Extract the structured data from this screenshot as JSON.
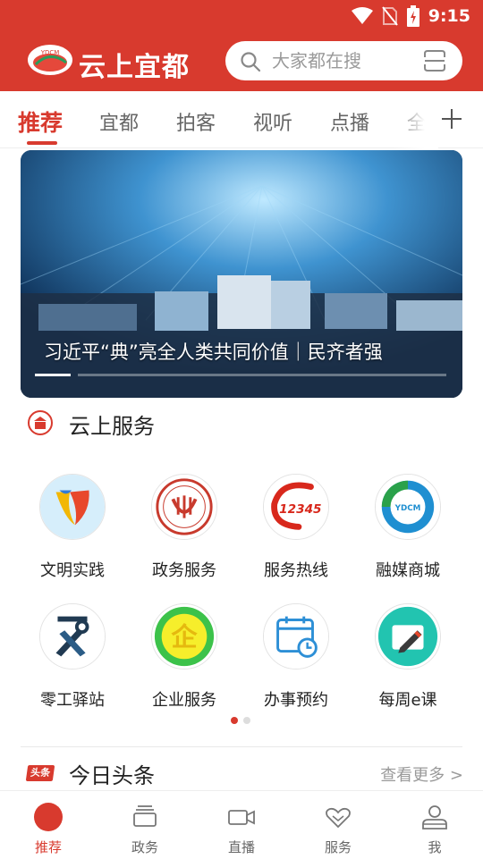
{
  "status_bar": {
    "time": "9:15"
  },
  "app": {
    "title": "云上宜都",
    "logo_text": "YDCM"
  },
  "search": {
    "placeholder": "大家都在搜"
  },
  "tabs": [
    {
      "label": "推荐",
      "active": true
    },
    {
      "label": "宜都"
    },
    {
      "label": "拍客"
    },
    {
      "label": "视听"
    },
    {
      "label": "点播"
    },
    {
      "label": "全"
    }
  ],
  "banner": {
    "caption": "习近平“典”亮全人类共同价值｜民齐者强"
  },
  "services_section": {
    "title": "云上服务",
    "items": [
      {
        "label": "文明实践",
        "icon": "civilization-icon"
      },
      {
        "label": "政务服务",
        "icon": "government-icon"
      },
      {
        "label": "服务热线",
        "icon": "hotline-12345-icon"
      },
      {
        "label": "融媒商城",
        "icon": "ydcm-mall-icon"
      },
      {
        "label": "零工驿站",
        "icon": "tools-icon"
      },
      {
        "label": "企业服务",
        "icon": "enterprise-icon",
        "glyph": "企"
      },
      {
        "label": "办事预约",
        "icon": "calendar-clock-icon"
      },
      {
        "label": "每周e课",
        "icon": "pencil-icon"
      }
    ],
    "hotline_number": "12345",
    "mall_logo_text": "YDCM"
  },
  "headlines": {
    "badge": "头条",
    "title": "今日头条",
    "more": "查看更多 >"
  },
  "bottom_nav": [
    {
      "label": "推荐",
      "active": true
    },
    {
      "label": "政务"
    },
    {
      "label": "直播"
    },
    {
      "label": "服务"
    },
    {
      "label": "我"
    }
  ],
  "colors": {
    "brand_red": "#d83a2e",
    "text_gray": "#666666"
  }
}
